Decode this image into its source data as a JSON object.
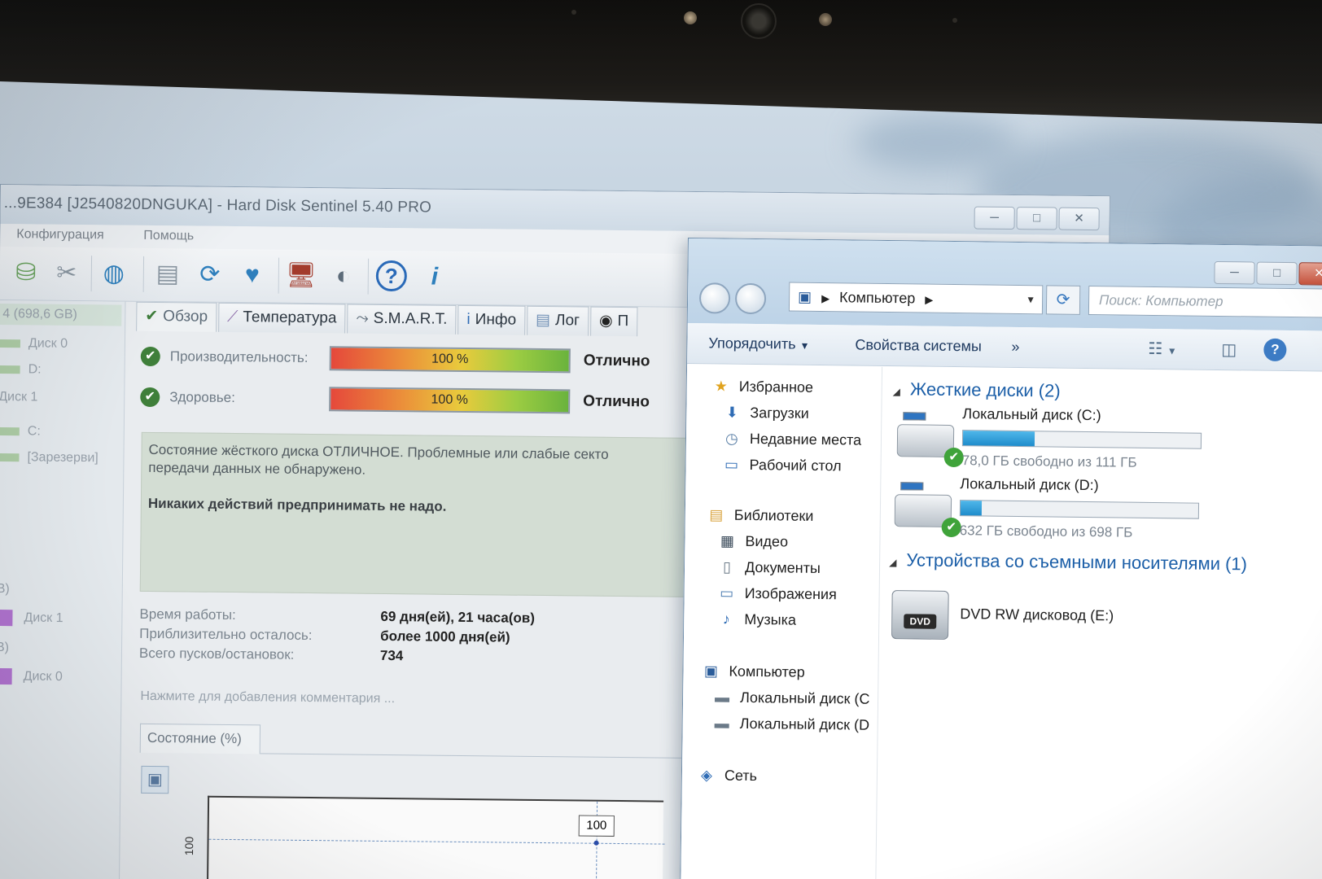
{
  "hds": {
    "title": "...9E384 [J2540820DNGUKA]  -  Hard Disk Sentinel 5.40 PRO",
    "menu": [
      "Конфигурация",
      "Помощь"
    ],
    "window_buttons": [
      "─",
      "□",
      "✕"
    ],
    "sidebar": {
      "disk_label": "4 (698,6 GB)",
      "rows": [
        "Диск 0",
        "D:",
        "Диск 1",
        "C:",
        "[Зарезерви]",
        "B)",
        "Диск 1",
        "B)",
        "Диск 0"
      ]
    },
    "tabs": [
      "Обзор",
      "Температура",
      "S.M.A.R.T.",
      "Инфо",
      "Лог",
      "П"
    ],
    "performance": {
      "label": "Производительность:",
      "value": "100 %",
      "percent": 100,
      "status": "Отлично"
    },
    "health": {
      "label": "Здоровье:",
      "value": "100 %",
      "percent": 100,
      "status": "Отлично"
    },
    "status_text_1": "Состояние жёсткого диска ОТЛИЧНОЕ. Проблемные или слабые секто",
    "status_text_2": "передачи данных не обнаружено.",
    "status_text_bold": "Никаких действий предпринимать не надо.",
    "info": [
      {
        "key": "Время работы:",
        "value": "69 дня(ей), 21 часа(ов)"
      },
      {
        "key": "Приблизительно осталось:",
        "value": "более 1000 дня(ей)"
      },
      {
        "key": "Всего пусков/остановок:",
        "value": "734"
      }
    ],
    "comment_placeholder": "Нажмите для добавления комментария ...",
    "chart_tab": "Состояние (%)",
    "chart_data": {
      "type": "line",
      "title": "Состояние (%)",
      "y_tick_labels": [
        "100"
      ],
      "points": [
        {
          "value": 100,
          "label": "100"
        }
      ]
    }
  },
  "explorer": {
    "window_buttons": [
      "─",
      "□",
      "✕"
    ],
    "address": "Компьютер",
    "search_placeholder": "Поиск: Компьютер",
    "commands": [
      "Упорядочить",
      "Свойства системы",
      "»"
    ],
    "nav": {
      "favorites": "Избранное",
      "fav_items": [
        "Загрузки",
        "Недавние места",
        "Рабочий стол"
      ],
      "libraries": "Библиотеки",
      "lib_items": [
        "Видео",
        "Документы",
        "Изображения",
        "Музыка"
      ],
      "computer": "Компьютер",
      "comp_items": [
        "Локальный диск (C",
        "Локальный диск (D"
      ],
      "network": "Сеть"
    },
    "hard_disks_header": "Жесткие диски (2)",
    "drives": [
      {
        "name": "Локальный диск (C:)",
        "free": "78,0 ГБ свободно из 111 ГБ",
        "used_fraction": 0.3
      },
      {
        "name": "Локальный диск (D:)",
        "free": "632 ГБ свободно из 698 ГБ",
        "used_fraction": 0.09
      }
    ],
    "removable_header": "Устройства со съемными носителями (1)",
    "dvd": {
      "name": "DVD RW дисковод (E:)",
      "tag": "DVD"
    }
  },
  "icons": {
    "check": "✔",
    "star": "★",
    "thermometer": "🌡",
    "info": "ⓘ",
    "log": "▤",
    "question": "?",
    "i": "i",
    "save": "💾",
    "refresh": "⟳",
    "folder": "📁",
    "film": "🎞",
    "doc": "📄",
    "image": "🖼",
    "music": "♪",
    "computer": "🖥",
    "network": "🌐",
    "download": "⬇",
    "clock": "◷",
    "desktop": "▭"
  },
  "colors": {
    "accent": "#1c5fa8",
    "ok_green": "#3f7f3a",
    "drive_fill": "#1f8ccb"
  }
}
